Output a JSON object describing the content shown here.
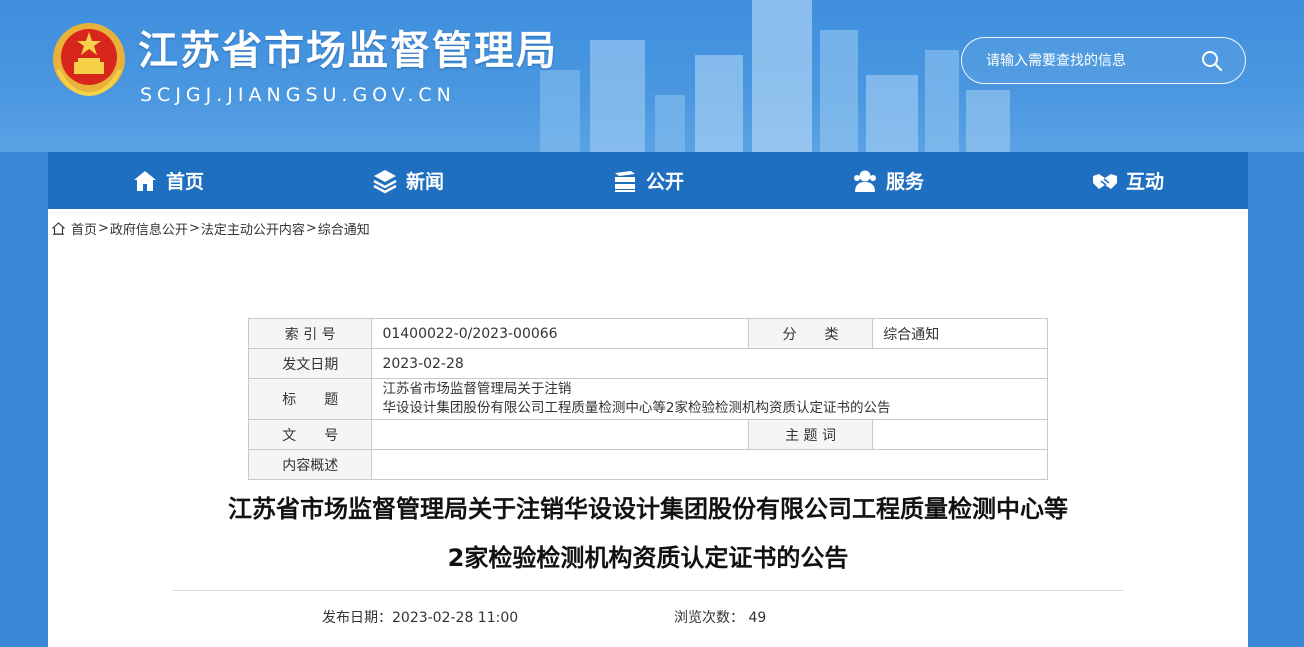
{
  "header": {
    "site_title": "江苏省市场监督管理局",
    "site_domain": "SCJGJ.JIANGSU.GOV.CN",
    "search": {
      "placeholder": "请输入需要查找的信息",
      "icon": "search-icon"
    }
  },
  "nav": {
    "items": [
      {
        "label": "首页",
        "icon": "home-icon"
      },
      {
        "label": "新闻",
        "icon": "layers-icon"
      },
      {
        "label": "公开",
        "icon": "books-icon"
      },
      {
        "label": "服务",
        "icon": "users-icon"
      },
      {
        "label": "互动",
        "icon": "handshake-icon"
      }
    ]
  },
  "breadcrumb": {
    "items": [
      "首页",
      "政府信息公开",
      "法定主动公开内容",
      "综合通知"
    ],
    "separator": ">"
  },
  "meta": {
    "index_label": "索 引 号",
    "index_value": "01400022-0/2023-00066",
    "category_label": "分　　类",
    "category_value": "综合通知",
    "date_label": "发文日期",
    "date_value": "2023-02-28",
    "title_label": "标　　题",
    "title_value_line1": "江苏省市场监督管理局关于注销",
    "title_value_line2": "华设设计集团股份有限公司工程质量检测中心等2家检验检测机构资质认定证书的公告",
    "docno_label": "文　　号",
    "docno_value": "",
    "keywords_label": "主 题 词",
    "keywords_value": "",
    "summary_label": "内容概述",
    "summary_value": ""
  },
  "article": {
    "title_line1": "江苏省市场监督管理局关于注销华设设计集团股份有限公司工程质量检测中心等",
    "title_line2": "2家检验检测机构资质认定证书的公告",
    "publish_label": "发布日期：",
    "publish_value": "2023-02-28 11:00",
    "views_label": "浏览次数：",
    "views_value": "49"
  }
}
